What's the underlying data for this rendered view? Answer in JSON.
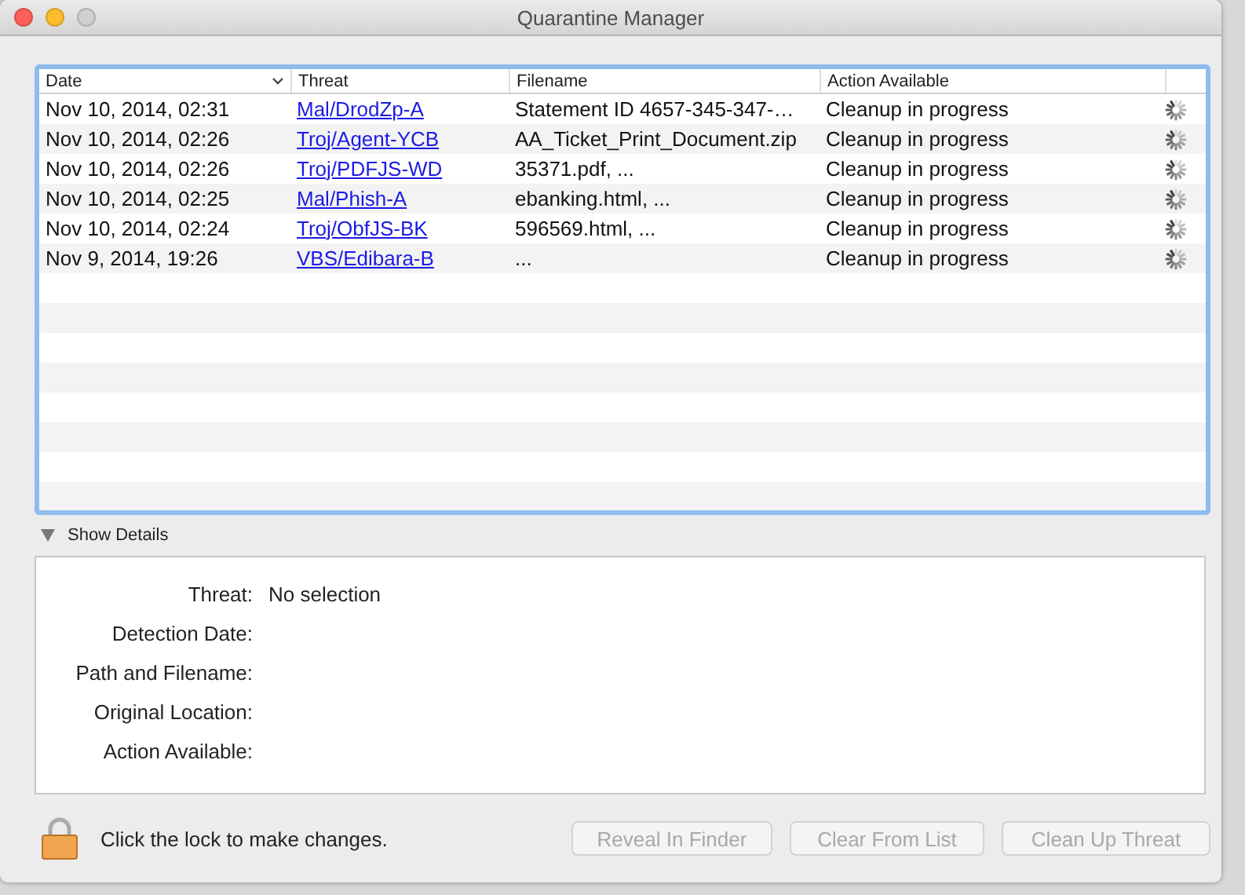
{
  "window": {
    "title": "Quarantine Manager"
  },
  "table": {
    "columns": [
      {
        "label": "Date",
        "sorted": true
      },
      {
        "label": "Threat",
        "sorted": false
      },
      {
        "label": "Filename",
        "sorted": false
      },
      {
        "label": "Action Available",
        "sorted": false
      }
    ],
    "rows": [
      {
        "date": "Nov 10, 2014, 02:31",
        "threat": "Mal/DrodZp-A",
        "filename": "Statement ID 4657-345-347-…",
        "action": "Cleanup in progress",
        "busy": true
      },
      {
        "date": "Nov 10, 2014, 02:26",
        "threat": "Troj/Agent-YCB",
        "filename": "AA_Ticket_Print_Document.zip",
        "action": "Cleanup in progress",
        "busy": true
      },
      {
        "date": "Nov 10, 2014, 02:26",
        "threat": "Troj/PDFJS-WD",
        "filename": "35371.pdf, ...",
        "action": "Cleanup in progress",
        "busy": true
      },
      {
        "date": "Nov 10, 2014, 02:25",
        "threat": "Mal/Phish-A",
        "filename": "ebanking.html, ...",
        "action": "Cleanup in progress",
        "busy": true
      },
      {
        "date": "Nov 10, 2014, 02:24",
        "threat": "Troj/ObfJS-BK",
        "filename": "596569.html, ...",
        "action": "Cleanup in progress",
        "busy": true
      },
      {
        "date": "Nov 9, 2014, 19:26",
        "threat": "VBS/Edibara-B",
        "filename": "...",
        "action": "Cleanup in progress",
        "busy": true
      }
    ]
  },
  "details": {
    "toggle": "Show Details",
    "expanded": true,
    "fields": [
      {
        "label": "Threat:",
        "value": "No selection"
      },
      {
        "label": "Detection Date:"
      },
      {
        "label": "Path and Filename:"
      },
      {
        "label": "Original Location:"
      },
      {
        "label": "Action Available:"
      }
    ]
  },
  "lock": {
    "text": "Click the lock to make changes."
  },
  "buttons": [
    {
      "label": "Reveal In Finder",
      "disabled": true
    },
    {
      "label": "Clear From List",
      "disabled": true
    },
    {
      "label": "Clean Up Threat",
      "disabled": true
    }
  ]
}
